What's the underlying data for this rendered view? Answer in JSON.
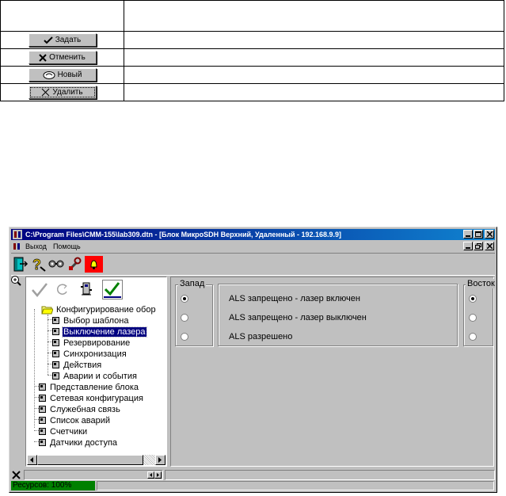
{
  "doc_table": {
    "rows": [
      {
        "label": "Задать",
        "icon": "check-icon"
      },
      {
        "label": "Отменить",
        "icon": "x-icon"
      },
      {
        "label": "Новый",
        "icon": "cloud-icon"
      },
      {
        "label": "Удалить",
        "icon": "cross-icon"
      }
    ]
  },
  "window": {
    "title": "C:\\Program Files\\CMM-155\\lab309.dtn - [Блок МикроSDH Верхний, Удаленный - 192.168.9.9]",
    "menu": [
      "Выход",
      "Помощь"
    ]
  },
  "tree": {
    "root": "Конфигурирование обор",
    "children": [
      "Выбор шаблона",
      "Выключение лазера",
      "Резервирование",
      "Синхронизация",
      "Действия",
      "Аварии и события"
    ],
    "selected_index": 1,
    "top_items": [
      "Представление блока",
      "Сетевая конфигурация",
      "Служебная связь",
      "Список аварий",
      "Счетчики",
      "Датчики доступа"
    ]
  },
  "settings": {
    "west_label": "Запад",
    "east_label": "Восток",
    "options": [
      "ALS запрещено - лазер включен",
      "ALS запрещено - лазер выключен",
      "ALS разрешено"
    ],
    "west_selected": 0,
    "east_selected": 0
  },
  "status": {
    "resources": "Ресурсов: 100%"
  },
  "colors": {
    "title_start": "#000080",
    "title_end": "#1084d0",
    "selection": "#000080",
    "resources_bar": "#008000",
    "window_bg": "#c0c0c0"
  }
}
